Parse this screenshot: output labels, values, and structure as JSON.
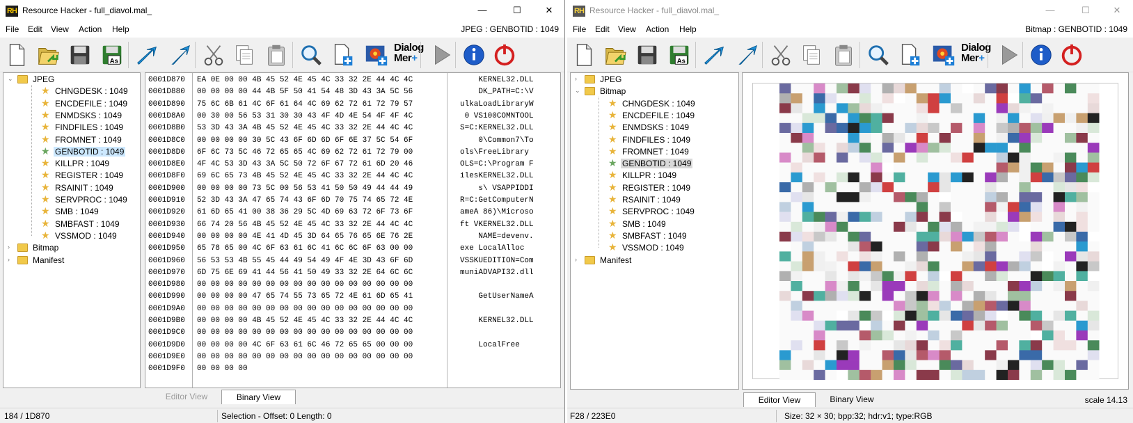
{
  "left": {
    "title": "Resource Hacker - full_diavol.mal_",
    "icon_text": "RH",
    "menu": [
      "File",
      "Edit",
      "View",
      "Action",
      "Help"
    ],
    "resource_label": "JPEG : GENBOTID : 1049",
    "tree": {
      "groups": [
        {
          "label": "JPEG",
          "expanded": true,
          "items": [
            "CHNGDESK : 1049",
            "ENCDEFILE : 1049",
            "ENMDSKS : 1049",
            "FINDFILES : 1049",
            "FROMNET : 1049",
            "GENBOTID : 1049",
            "KILLPR : 1049",
            "REGISTER : 1049",
            "RSAINIT : 1049",
            "SERVPROC : 1049",
            "SMB : 1049",
            "SMBFAST : 1049",
            "VSSMOD : 1049"
          ],
          "selected": 5
        },
        {
          "label": "Bitmap",
          "expanded": false,
          "items": []
        },
        {
          "label": "Manifest",
          "expanded": false,
          "items": []
        }
      ]
    },
    "hex": {
      "addresses": [
        "0001D870",
        "0001D880",
        "0001D890",
        "0001D8A0",
        "0001D8B0",
        "0001D8C0",
        "0001D8D0",
        "0001D8E0",
        "0001D8F0",
        "0001D900",
        "0001D910",
        "0001D920",
        "0001D930",
        "0001D940",
        "0001D950",
        "0001D960",
        "0001D970",
        "0001D980",
        "0001D990",
        "0001D9A0",
        "0001D9B0",
        "0001D9C0",
        "0001D9D0",
        "0001D9E0",
        "0001D9F0"
      ],
      "bytes": [
        "EA 0E 00 00 4B 45 52 4E 45 4C 33 32 2E 44 4C 4C",
        "00 00 00 00 44 4B 5F 50 41 54 48 3D 43 3A 5C 56",
        "75 6C 6B 61 4C 6F 61 64 4C 69 62 72 61 72 79 57",
        "00 30 00 56 53 31 30 30 43 4F 4D 4E 54 4F 4F 4C",
        "53 3D 43 3A 4B 45 52 4E 45 4C 33 32 2E 44 4C 4C",
        "00 00 00 00 30 5C 43 6F 6D 6D 6F 6E 37 5C 54 6F",
        "6F 6C 73 5C 46 72 65 65 4C 69 62 72 61 72 79 00",
        "4F 4C 53 3D 43 3A 5C 50 72 6F 67 72 61 6D 20 46",
        "69 6C 65 73 4B 45 52 4E 45 4C 33 32 2E 44 4C 4C",
        "00 00 00 00 73 5C 00 56 53 41 50 50 49 44 44 49",
        "52 3D 43 3A 47 65 74 43 6F 6D 70 75 74 65 72 4E",
        "61 6D 65 41 00 38 36 29 5C 4D 69 63 72 6F 73 6F",
        "66 74 20 56 4B 45 52 4E 45 4C 33 32 2E 44 4C 4C",
        "00 00 00 00 4E 41 4D 45 3D 64 65 76 65 6E 76 2E",
        "65 78 65 00 4C 6F 63 61 6C 41 6C 6C 6F 63 00 00",
        "56 53 53 4B 55 45 44 49 54 49 4F 4E 3D 43 6F 6D",
        "6D 75 6E 69 41 44 56 41 50 49 33 32 2E 64 6C 6C",
        "00 00 00 00 00 00 00 00 00 00 00 00 00 00 00 00",
        "00 00 00 00 47 65 74 55 73 65 72 4E 61 6D 65 41",
        "00 00 00 00 00 00 00 00 00 00 00 00 00 00 00 00",
        "00 00 00 00 4B 45 52 4E 45 4C 33 32 2E 44 4C 4C",
        "00 00 00 00 00 00 00 00 00 00 00 00 00 00 00 00",
        "00 00 00 00 4C 6F 63 61 6C 46 72 65 65 00 00 00",
        "00 00 00 00 00 00 00 00 00 00 00 00 00 00 00 00",
        "00 00 00 00"
      ],
      "ascii": [
        "    KERNEL32.DLL",
        "    DK_PATH=C:\\V",
        "ulkaLoadLibraryW",
        " 0 VS100COMNTOOL",
        "S=C:KERNEL32.DLL",
        "    0\\Common7\\To",
        "ols\\FreeLibrary",
        "OLS=C:\\Program F",
        "ilesKERNEL32.DLL",
        "    s\\ VSAPPIDDI",
        "R=C:GetComputerN",
        "ameA 86)\\Microso",
        "ft VKERNEL32.DLL",
        "    NAME=devenv.",
        "exe LocalAlloc",
        "VSSKUEDITION=Com",
        "muniADVAPI32.dll",
        "",
        "    GetUserNameA",
        "",
        "    KERNEL32.DLL",
        "",
        "    LocalFree",
        "",
        ""
      ]
    },
    "tabs": [
      "Editor View",
      "Binary View"
    ],
    "status": {
      "position": "184 / 1D870",
      "selection": "Selection - Offset: 0 Length: 0"
    }
  },
  "right": {
    "title": "Resource Hacker - full_diavol.mal_",
    "icon_text": "RH",
    "menu": [
      "File",
      "Edit",
      "View",
      "Action",
      "Help"
    ],
    "resource_label": "Bitmap : GENBOTID : 1049",
    "tree": {
      "groups": [
        {
          "label": "JPEG",
          "expanded": false,
          "items": []
        },
        {
          "label": "Bitmap",
          "expanded": true,
          "items": [
            "CHNGDESK : 1049",
            "ENCDEFILE : 1049",
            "ENMDSKS : 1049",
            "FINDFILES : 1049",
            "FROMNET : 1049",
            "GENBOTID : 1049",
            "KILLPR : 1049",
            "REGISTER : 1049",
            "RSAINIT : 1049",
            "SERVPROC : 1049",
            "SMB : 1049",
            "SMBFAST : 1049",
            "VSSMOD : 1049"
          ],
          "selected": 5
        },
        {
          "label": "Manifest",
          "expanded": false,
          "items": []
        }
      ]
    },
    "tabs": [
      "Editor View",
      "Binary View"
    ],
    "scale": "scale 14.13",
    "status": {
      "position": "F28 / 223E0",
      "info": "Size: 32 × 30;  bpp:32;  hdr:v1;  type:RGB"
    }
  },
  "toolbar_icons": [
    "new-file-icon",
    "open-file-icon",
    "save-icon",
    "save-as-icon",
    "compile-icon",
    "go-icon",
    "cut-icon",
    "copy-icon",
    "paste-icon",
    "find-icon",
    "add-resource-icon",
    "replace-bitmap-icon",
    "dialog-merge-icon",
    "run-script-icon",
    "about-icon",
    "exit-icon"
  ],
  "toolbar_dialog_text": [
    "Dialog",
    "Mer"
  ],
  "caption_glyphs": {
    "minimize": "—",
    "maximize": "☐",
    "close": "✕"
  },
  "colors": {
    "selection": "#cce8ff",
    "folder": "#f1c94a",
    "accent": "#1e7fd6"
  }
}
